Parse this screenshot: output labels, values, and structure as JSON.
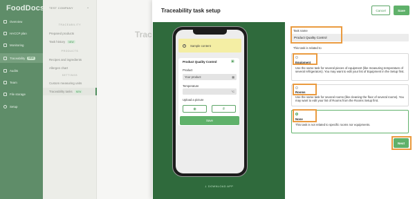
{
  "app": {
    "brand": "FoodDocs"
  },
  "sidebar": {
    "items": [
      {
        "label": "Overview",
        "icon": "grid-icon"
      },
      {
        "label": "HACCP plan",
        "icon": "document-icon"
      },
      {
        "label": "Monitoring",
        "icon": "chart-icon"
      },
      {
        "label": "Traceability",
        "icon": "leaf-icon",
        "badge": "NEW",
        "active": true
      },
      {
        "label": "Audits",
        "icon": "clipboard-icon"
      },
      {
        "label": "Team",
        "icon": "people-icon"
      },
      {
        "label": "File storage",
        "icon": "folder-icon"
      },
      {
        "label": "Setup",
        "icon": "gear-icon"
      }
    ]
  },
  "submenu": {
    "company": "TEST COMPANY",
    "sections": [
      {
        "heading": "TRACEABILITY",
        "items": [
          {
            "label": "Prepared products"
          },
          {
            "label": "Task history",
            "badge": "NEW"
          }
        ]
      },
      {
        "heading": "PRODUCTS",
        "items": [
          {
            "label": "Recipes and ingredients"
          },
          {
            "label": "Allergen chart"
          }
        ]
      },
      {
        "heading": "SETTINGS",
        "items": [
          {
            "label": "Custom measuring units"
          },
          {
            "label": "Traceability tasks",
            "badge": "NEW",
            "active": true
          }
        ]
      }
    ]
  },
  "background": {
    "title": "Trace"
  },
  "modal": {
    "title": "Traceability task setup",
    "cancel": "Cancel",
    "save": "Save",
    "next": "Next"
  },
  "preview": {
    "sample": "Sample content",
    "card_title": "Product Quality Control",
    "product_label": "Product",
    "product_value": "Your product",
    "temperature_label": "Temperature",
    "temperature_unit": "°C",
    "upload_label": "Upload a picture",
    "save": "Save",
    "download": "DOWNLOAD APP"
  },
  "form": {
    "task_name_label": "Task name",
    "task_name_value": "Product Quality Control",
    "related_label": "This task is related to",
    "options": [
      {
        "title": "Equipment",
        "description": "Use the same task for several pieces of equipment (like measuring temperature of several refrigerators). You may want to edit your list of Equipment in the Setup first.",
        "selected": false
      },
      {
        "title": "Rooms",
        "description": "Use the same task for several rooms (like cleaning the floor of several rooms). You may want to edit your list of Rooms from the Rooms Setup first.",
        "selected": false
      },
      {
        "title": "None",
        "description": "This task is not related to specific rooms nor equipments.",
        "selected": true
      }
    ]
  },
  "colors": {
    "accent_green": "#5fb16a",
    "preview_green": "#2f6a3c",
    "sidebar_green": "#5f8d69",
    "highlight_orange": "#ea9a3e"
  }
}
